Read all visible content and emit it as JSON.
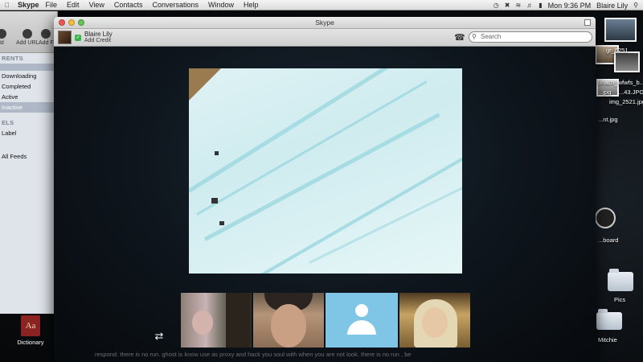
{
  "menubar": {
    "app_name": "Skype",
    "items": [
      "File",
      "Edit",
      "View",
      "Contacts",
      "Conversations",
      "Window",
      "Help"
    ],
    "clock": "Mon 9:36 PM",
    "user": "Blaire Lily"
  },
  "background_window": {
    "toolbar": [
      "ld",
      "Add URL",
      "Add F"
    ],
    "sections": [
      {
        "title": "RENTS",
        "rows": [
          "Downloading",
          "Completed",
          "Active",
          "Inactive"
        ],
        "selected": "Inactive"
      },
      {
        "title": "ELS",
        "rows": [
          "Label"
        ]
      },
      {
        "title": "",
        "rows": [
          "All Feeds"
        ]
      }
    ]
  },
  "dock_item": {
    "label": "Dictionary",
    "glyph": "Aa"
  },
  "desktop": {
    "files": [
      "gr_6251...",
      "bhach_wfwfs_b...",
      "...jpg",
      "...43.JPG",
      "img_2521.jpg",
      "...nt.jpg",
      "...board",
      "Pics",
      "Mitchie"
    ]
  },
  "skype": {
    "window_title": "Skype",
    "user_name": "Blaire Lily",
    "add_credit": "Add Credit",
    "search_placeholder": "Search",
    "status_color": "#3bb54a",
    "swap_icon": "swap-arrows-icon"
  },
  "subtitle_text": "respond. there is no run. ghost is know use as proxy and hack you soul with when you are not look. there is no run , be"
}
